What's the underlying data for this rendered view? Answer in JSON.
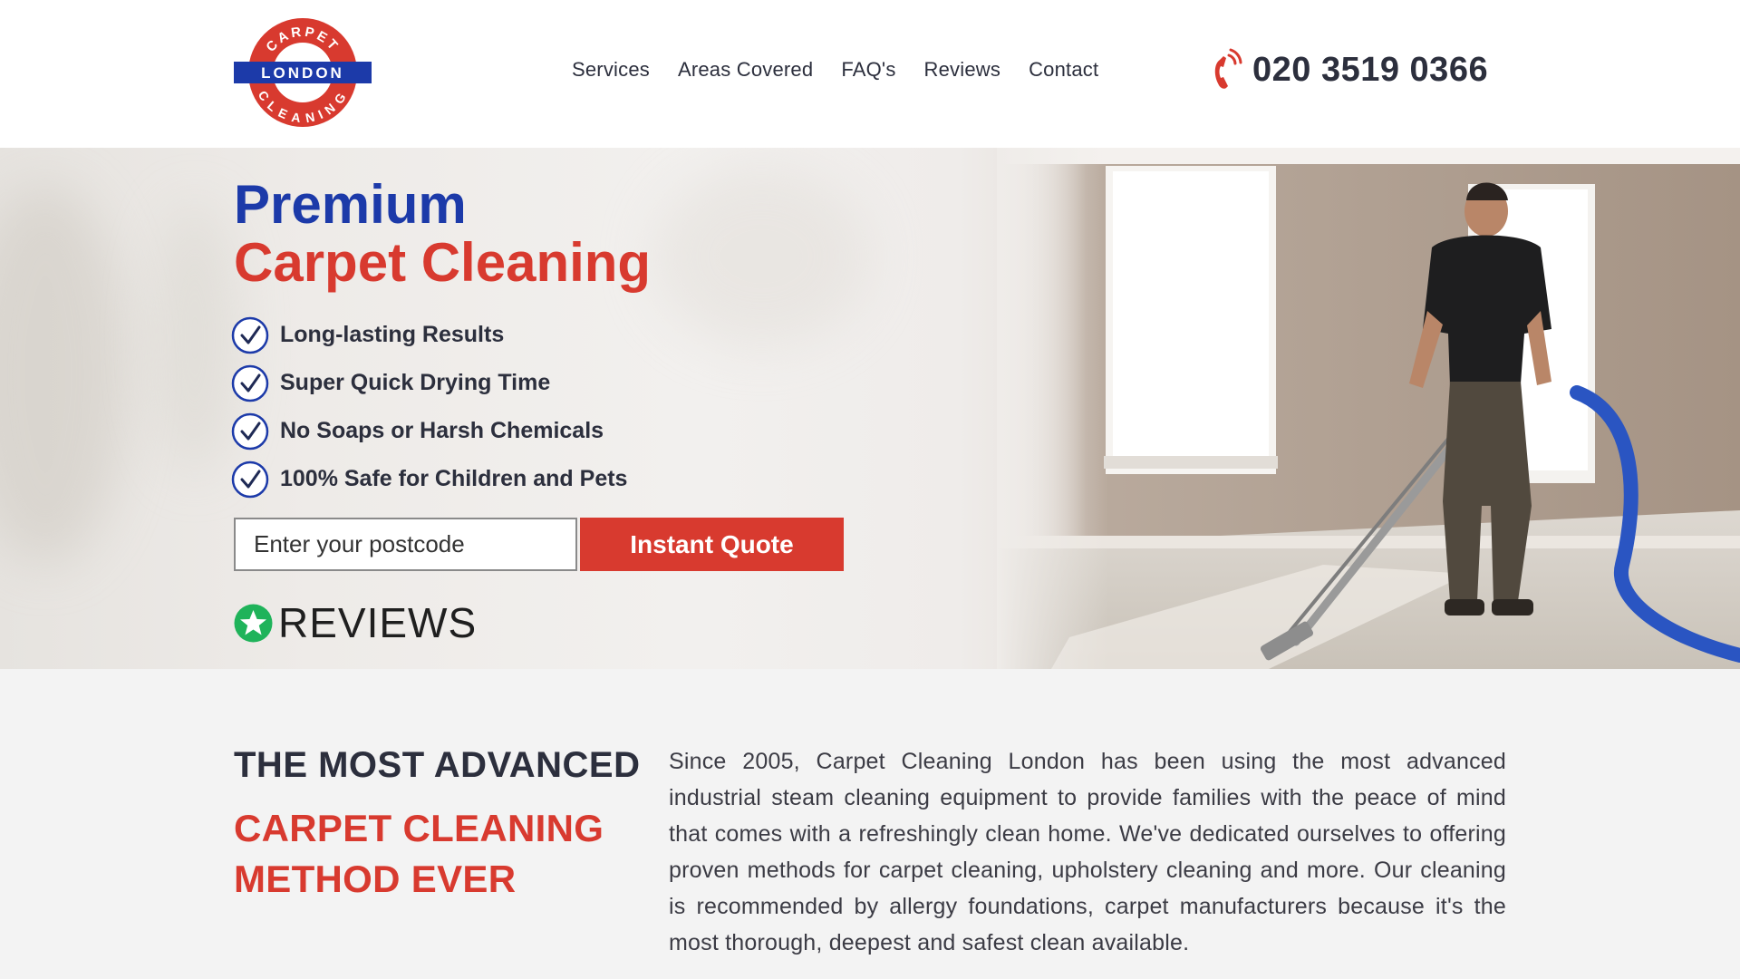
{
  "logo": {
    "top_text": "CARPET",
    "middle_text": "LONDON",
    "bottom_text": "CLEANING",
    "ring_color": "#d83a2f",
    "band_color": "#1c3aa9"
  },
  "nav": {
    "items": [
      "Services",
      "Areas Covered",
      "FAQ's",
      "Reviews",
      "Contact"
    ]
  },
  "phone": {
    "icon": "phone-ringing-icon",
    "number": "020 3519 0366"
  },
  "hero": {
    "headline_line1": "Premium",
    "headline_line2": "Carpet Cleaning",
    "features": [
      "Long-lasting Results",
      "Super Quick Drying Time",
      "No Soaps or Harsh Chemicals",
      "100% Safe for Children and Pets"
    ],
    "feature_icon": "check-circle-icon",
    "postcode_placeholder": "Enter your postcode",
    "quote_button": "Instant Quote",
    "reviews_label": "REVIEWS",
    "reviews_icon": "green-star-icon"
  },
  "about": {
    "heading_small": "THE MOST ADVANCED",
    "heading_big": "CARPET CLEANING METHOD EVER",
    "body": "Since 2005, Carpet Cleaning London has been using the most advanced industrial steam cleaning equipment to provide families with the peace of mind that comes with a refreshingly clean home. We've dedicated ourselves to offering proven methods for carpet cleaning, upholstery cleaning and more. Our cleaning is recommended by allergy foundations, carpet manufacturers because it's the most thorough, deepest and safest clean available."
  },
  "colors": {
    "brand_blue": "#1c3aa9",
    "brand_red": "#d83a2f",
    "text_dark": "#2c2f3d",
    "review_green": "#1fb35a"
  }
}
